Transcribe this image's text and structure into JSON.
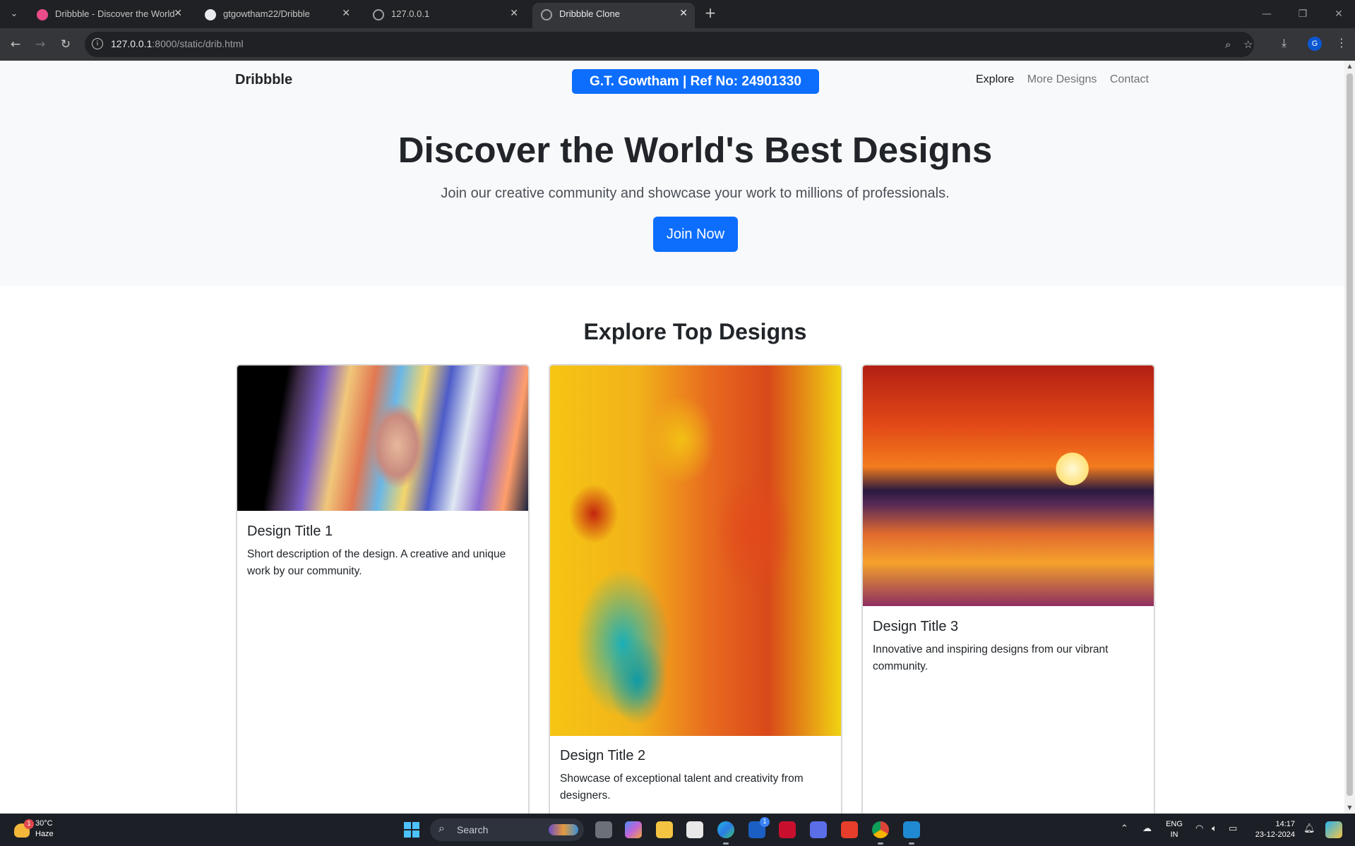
{
  "browser": {
    "tabs": [
      {
        "title": "Dribbble - Discover the World's",
        "favicon_color": "#ea4c89",
        "active": false
      },
      {
        "title": "gtgowtham22/Dribble",
        "favicon_color": "#e8eaed",
        "active": false
      },
      {
        "title": "127.0.0.1",
        "favicon_color": "#9aa0a6",
        "active": false
      },
      {
        "title": "Dribbble Clone",
        "favicon_color": "#9aa0a6",
        "active": true
      }
    ],
    "url_host": "127.0.0.1",
    "url_path": ":8000/static/drib.html",
    "profile_initial": "G"
  },
  "page": {
    "brand": "Dribbble",
    "badge": "G.T. Gowtham | Ref No: 24901330",
    "nav": [
      "Explore",
      "More Designs",
      "Contact"
    ],
    "hero": {
      "title": "Discover the World's Best Designs",
      "subtitle": "Join our creative community and showcase your work to millions of professionals.",
      "button": "Join Now"
    },
    "section_title": "Explore Top Designs",
    "cards": [
      {
        "title": "Design Title 1",
        "description": "Short description of the design. A creative and unique work by our community."
      },
      {
        "title": "Design Title 2",
        "description": "Showcase of exceptional talent and creativity from designers."
      },
      {
        "title": "Design Title 3",
        "description": "Innovative and inspiring designs from our vibrant community."
      }
    ],
    "accent_color": "#0d6efd"
  },
  "taskbar": {
    "weather_temp": "30°C",
    "weather_cond": "Haze",
    "weather_badge": "1",
    "search_label": "Search",
    "outlook_badge": "1",
    "lang_line1": "ENG",
    "lang_line2": "IN",
    "time": "14:17",
    "date": "23-12-2024"
  }
}
